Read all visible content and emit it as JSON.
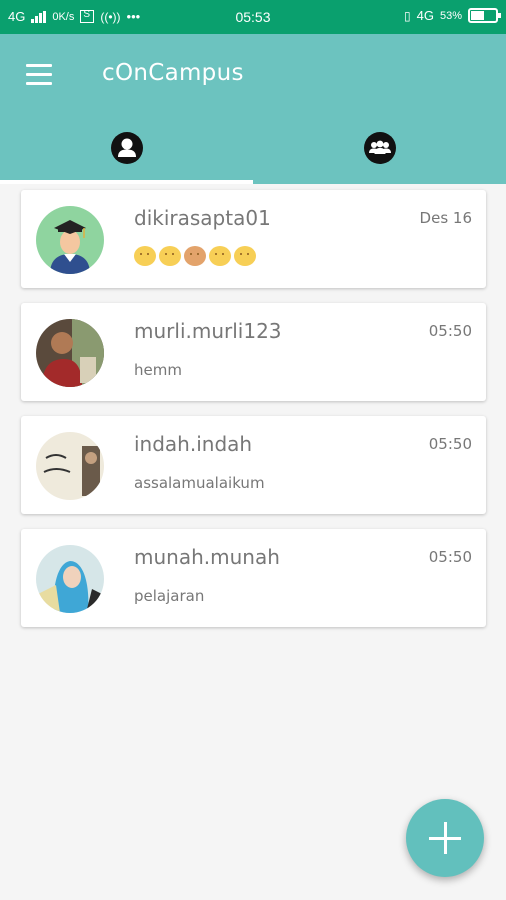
{
  "status_bar": {
    "network_left": "4G",
    "speed": "0K/s",
    "dots": "•••",
    "time": "05:53",
    "network_right": "4G",
    "battery": "53%",
    "battery_level": 0.53
  },
  "app_bar": {
    "title": "cOnCampus"
  },
  "tabs": [
    {
      "icon": "person-icon",
      "active": true
    },
    {
      "icon": "group-icon",
      "active": false
    }
  ],
  "chats": [
    {
      "name": "dikirasapta01",
      "time": "Des 16",
      "message": "",
      "emojis": [
        "smile",
        "smile",
        "dog",
        "grin",
        "smirk"
      ],
      "avatar": "graduate-avatar"
    },
    {
      "name": "murli.murli123",
      "time": "05:50",
      "message": "hemm",
      "avatar": "photo-avatar"
    },
    {
      "name": "indah.indah",
      "time": "05:50",
      "message": "assalamualaikum",
      "avatar": "photo-avatar"
    },
    {
      "name": "munah.munah",
      "time": "05:50",
      "message": "pelajaran",
      "avatar": "photo-avatar"
    }
  ],
  "fab": {
    "icon": "plus-icon"
  },
  "colors": {
    "status_bar": "#0aa06e",
    "app_bar": "#6cc3bf",
    "fab": "#62c0bd"
  }
}
